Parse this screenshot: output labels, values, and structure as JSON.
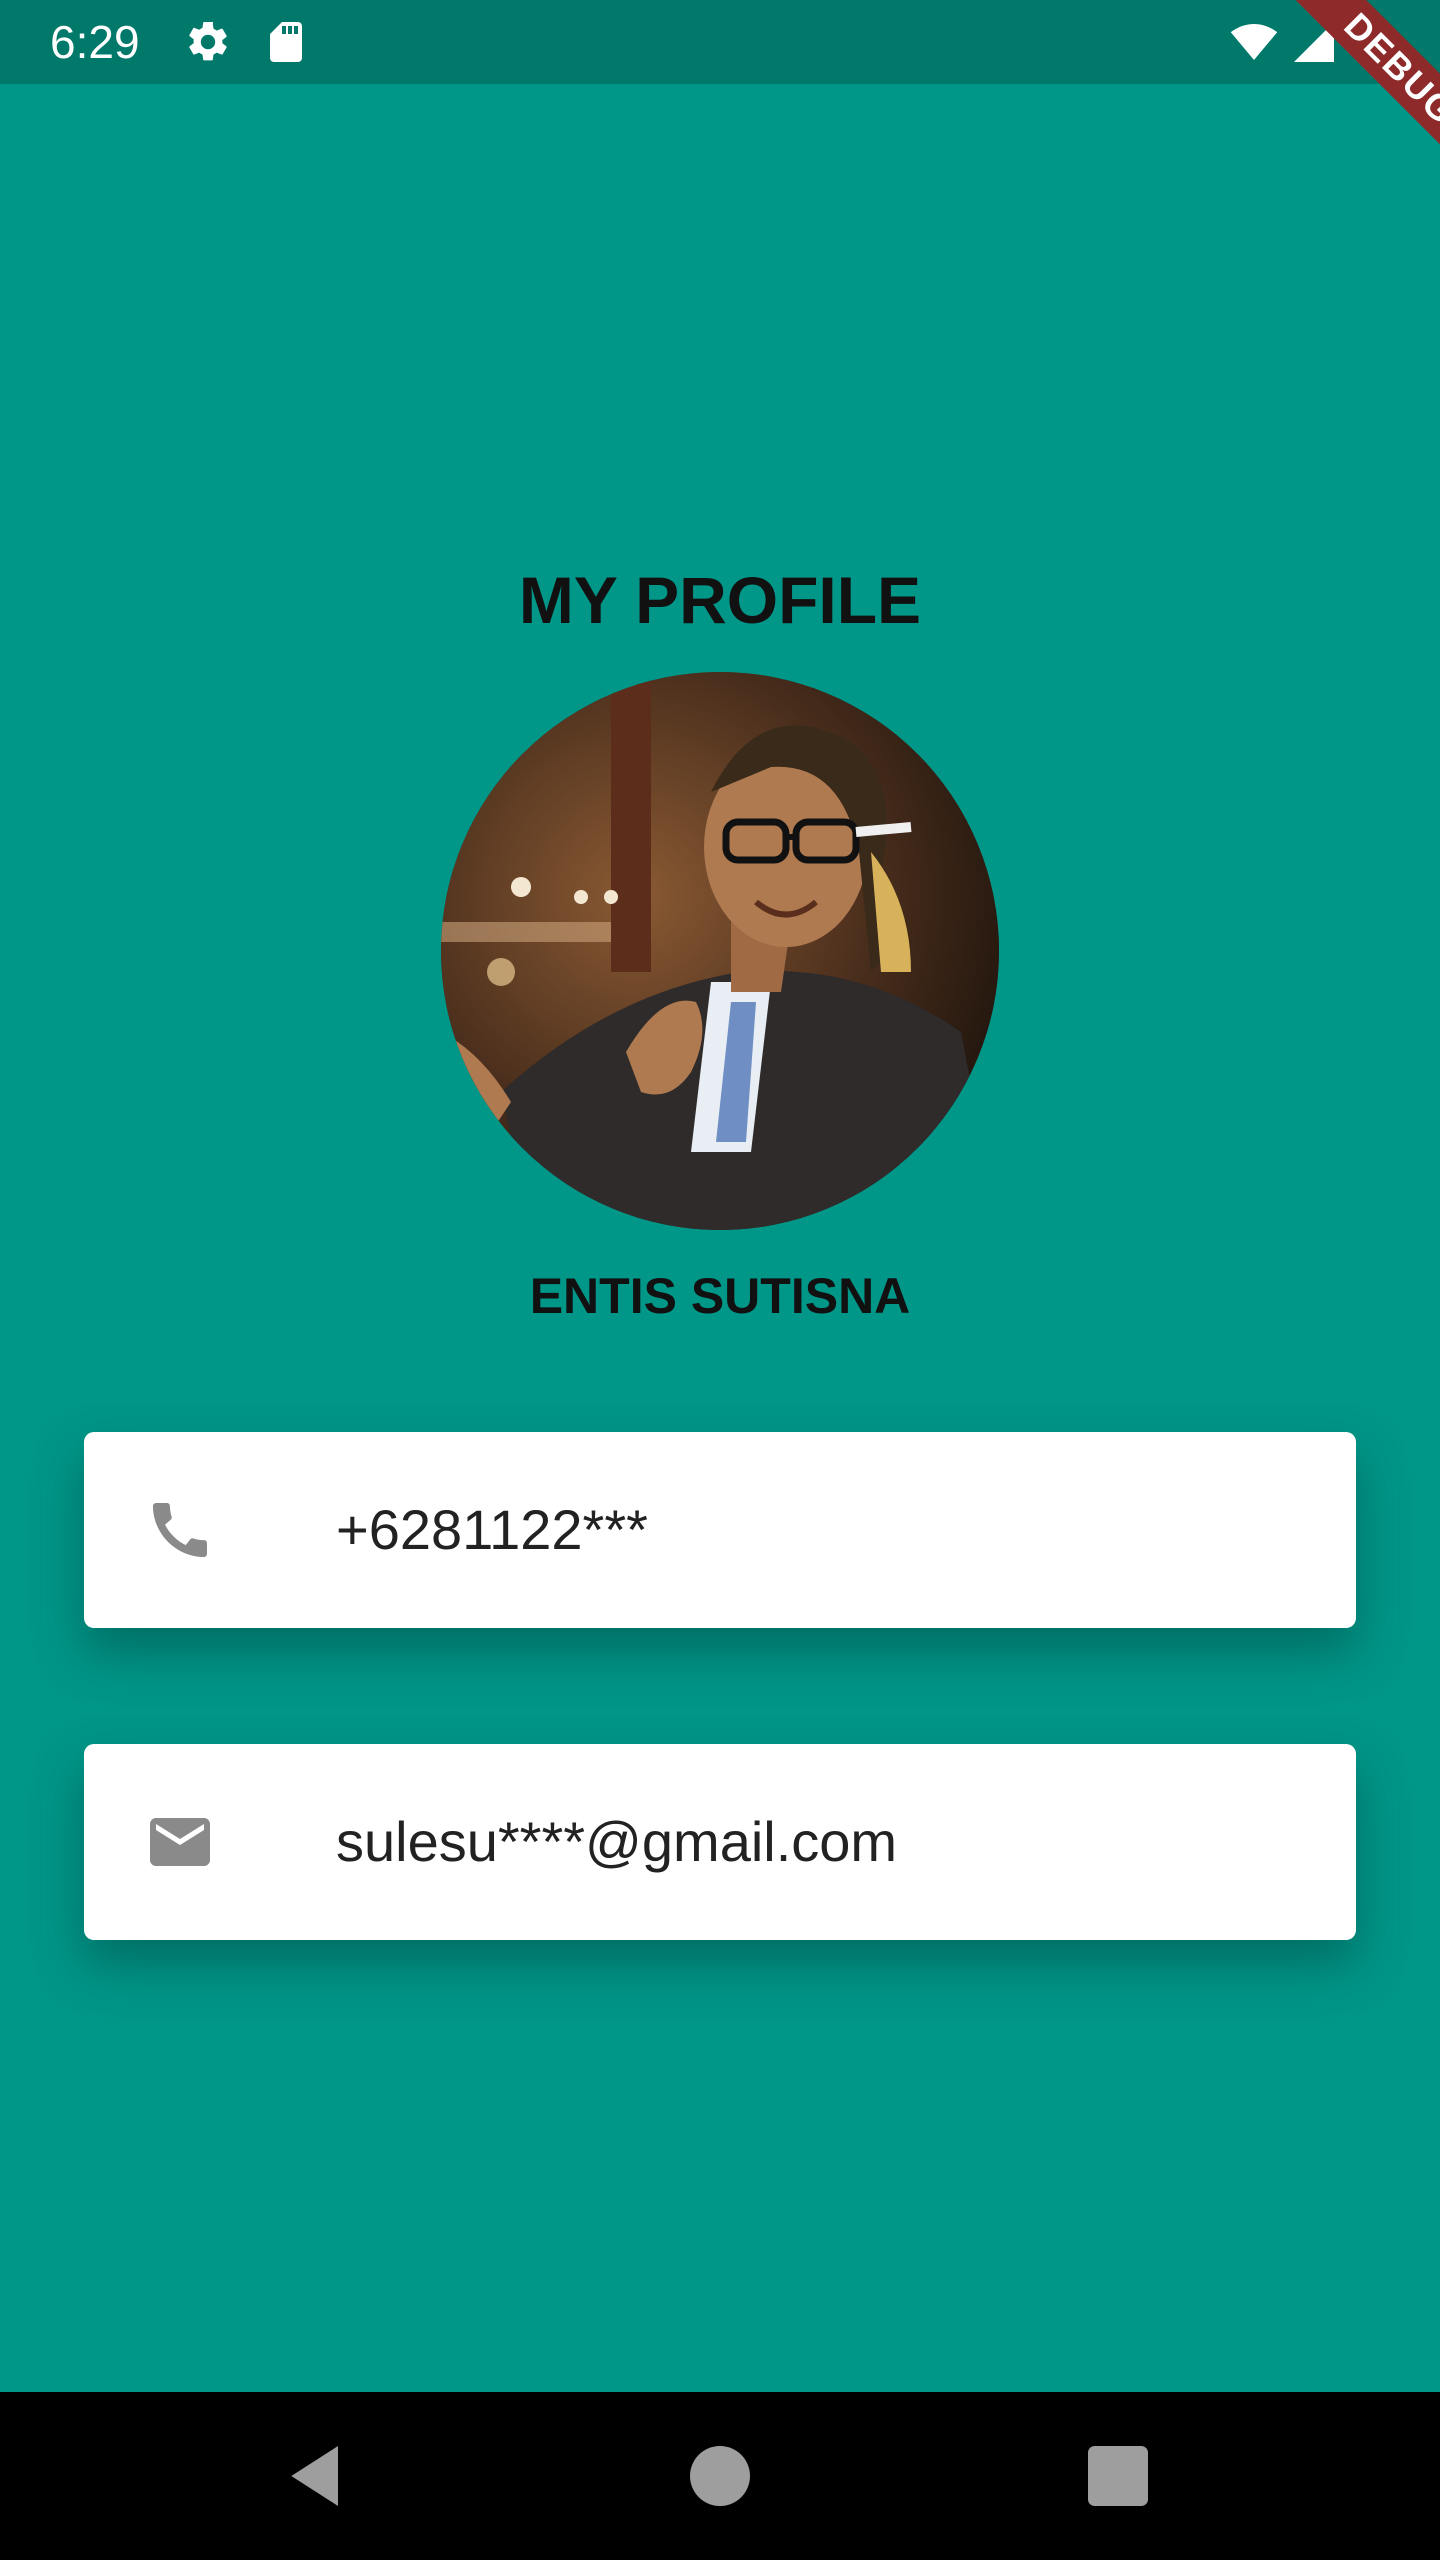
{
  "status_bar": {
    "time": "6:29",
    "icons": [
      "settings-icon",
      "sd-card-icon",
      "wifi-icon",
      "cell-signal-icon",
      "battery-icon"
    ]
  },
  "debug_banner": {
    "label": "DEBUG"
  },
  "profile": {
    "title": "MY PROFILE",
    "name": "ENTIS SUTISNA",
    "phone": "+6281122***",
    "email": "sulesu****@gmail.com"
  },
  "colors": {
    "background": "#009688",
    "status_bar": "#00796B",
    "card": "#ffffff",
    "icon": "#8a8a8a",
    "debug_ribbon": "#8E2A2A"
  },
  "nav_bar": {
    "buttons": [
      "back-icon",
      "home-icon",
      "recents-icon"
    ]
  }
}
